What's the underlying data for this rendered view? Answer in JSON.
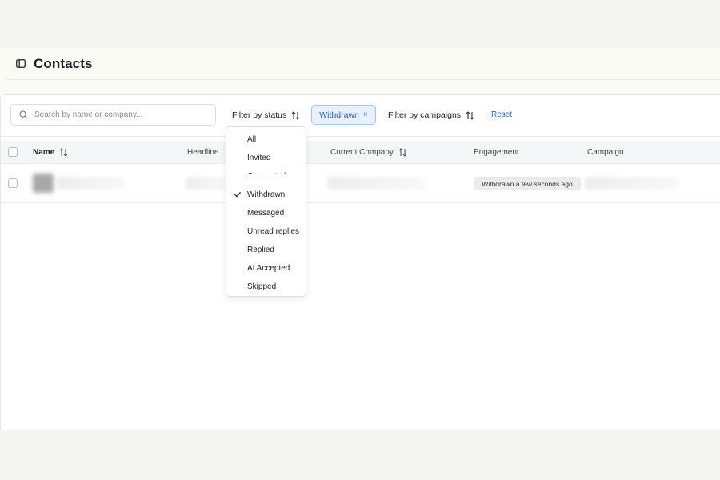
{
  "header": {
    "title": "Contacts",
    "icon": "sidebar-panel-icon"
  },
  "filters": {
    "search_placeholder": "Search by name or company...",
    "status_label": "Filter by status",
    "active_chip": "Withdrawn",
    "chip_remove": "×",
    "campaigns_label": "Filter by campaigns",
    "reset_label": "Reset"
  },
  "table": {
    "columns": [
      "Name",
      "Headline",
      "Current Company",
      "Engagement",
      "Campaign"
    ],
    "rows": [
      {
        "engagement": "Withdrawn a few seconds ago"
      }
    ]
  },
  "status_dropdown": {
    "options": [
      "All",
      "Invited",
      "Connected",
      "Withdrawn",
      "Messaged",
      "Unread replies",
      "Replied",
      "AI Accepted",
      "Skipped"
    ],
    "selected": "Withdrawn"
  },
  "colors": {
    "accent": "#2a5fb0",
    "chip_bg": "#e8f0fb",
    "chip_border": "#a9c4ec"
  }
}
